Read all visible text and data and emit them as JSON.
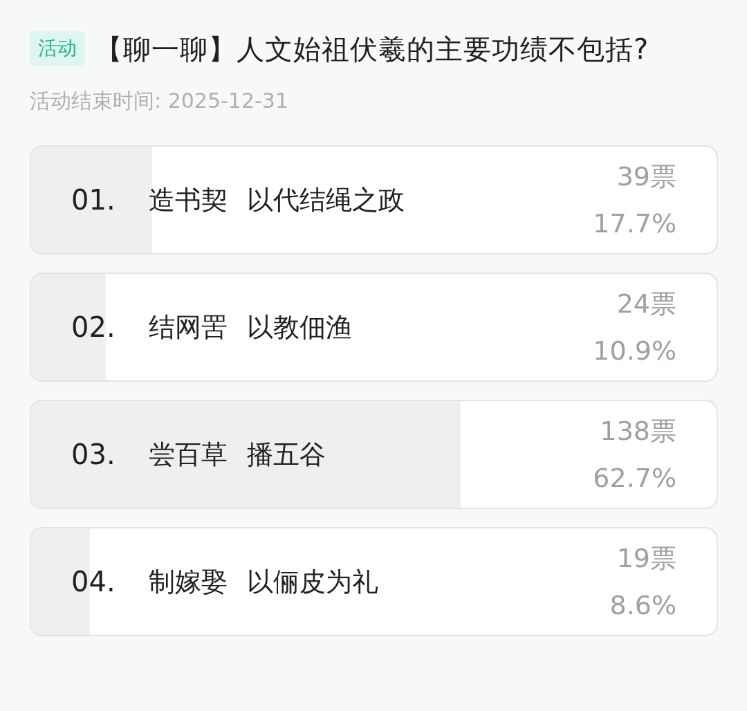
{
  "header": {
    "tag": "活动",
    "title": "【聊一聊】人文始祖伏羲的主要功绩不包括?",
    "end_time": "活动结束时间: 2025-12-31"
  },
  "options": [
    {
      "number": "01.",
      "label": "造书契 以代结绳之政",
      "votes": "39票",
      "percent": "17.7%",
      "level": 0.177
    },
    {
      "number": "02.",
      "label": "结网罟 以教佃渔",
      "votes": "24票",
      "percent": "10.9%",
      "level": 0.109
    },
    {
      "number": "03.",
      "label": "尝百草 播五谷",
      "votes": "138票",
      "percent": "62.7%",
      "level": 0.627
    },
    {
      "number": "04.",
      "label": "制嫁娶 以俪皮为礼",
      "votes": "19票",
      "percent": "8.6%",
      "level": 0.086
    }
  ]
}
